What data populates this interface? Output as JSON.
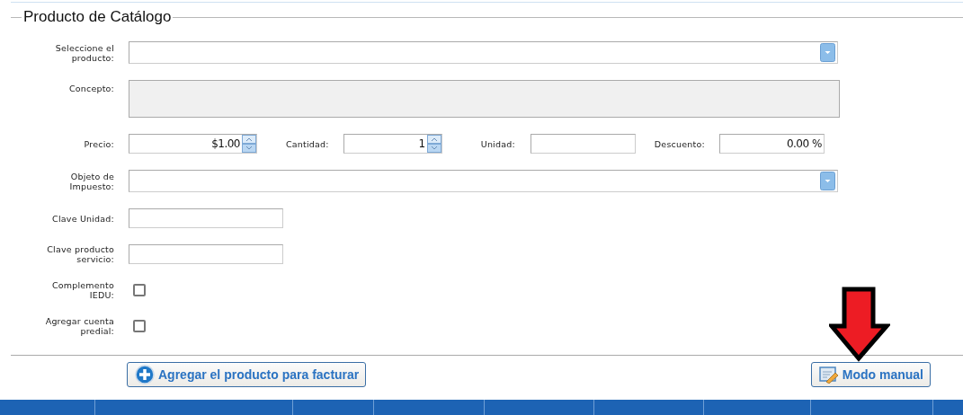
{
  "section": {
    "legend": "Producto de Catálogo"
  },
  "fields": [
    {
      "kind": "select",
      "label": "Seleccione el producto:"
    },
    {
      "kind": "textarea",
      "label": "Concepto:",
      "disabled": true
    },
    {
      "kind": "row",
      "label": "Precio:",
      "items": [
        {
          "kind": "spinner",
          "value": "$1.00"
        },
        {
          "kind": "spinner",
          "label": "Cantidad:",
          "value": "1"
        },
        {
          "kind": "text",
          "label": "Unidad:"
        },
        {
          "kind": "text",
          "label": "Descuento:",
          "value": "0.00 %"
        }
      ]
    },
    {
      "kind": "select",
      "label": "Objeto de Impuesto:"
    },
    {
      "kind": "text",
      "label": "Clave Unidad:"
    },
    {
      "kind": "text",
      "label": "Clave producto servicio:"
    },
    {
      "kind": "checkbox",
      "label": "Complemento IEDU:",
      "checked": false
    },
    {
      "kind": "checkbox",
      "label": "Agregar cuenta predial:",
      "checked": false
    }
  ],
  "buttons": [
    {
      "kind": "add",
      "label": "Agregar el producto para facturar"
    },
    {
      "kind": "manual",
      "label": "Modo manual"
    }
  ]
}
